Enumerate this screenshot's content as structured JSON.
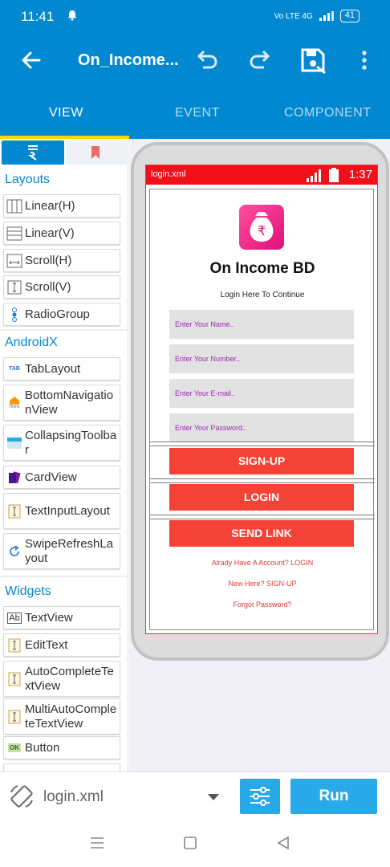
{
  "status_bar": {
    "time": "11:41",
    "network": "Vo LTE  4G",
    "battery": "41"
  },
  "toolbar": {
    "title": "On_Income..."
  },
  "tabs": [
    {
      "label": "VIEW",
      "active": true
    },
    {
      "label": "EVENT",
      "active": false
    },
    {
      "label": "COMPONENT",
      "active": false
    }
  ],
  "palette": {
    "sections": {
      "layouts": "Layouts",
      "androidx": "AndroidX",
      "widgets": "Widgets"
    },
    "layouts": [
      "Linear(H)",
      "Linear(V)",
      "Scroll(H)",
      "Scroll(V)",
      "RadioGroup"
    ],
    "androidx": [
      "TabLayout",
      "BottomNavigationView",
      "CollapsingToolbar",
      "CardView",
      "TextInputLayout",
      "SwipeRefreshLayout"
    ],
    "widgets": [
      "TextView",
      "EditText",
      "AutoCompleteTextView",
      "MultiAutoCompleteTextView",
      "Button"
    ],
    "icon_tags": {
      "tab": "TAB",
      "home": "Home",
      "ab": "Ab",
      "ok": "OK"
    }
  },
  "preview": {
    "file": "login.xml",
    "time": "1:37",
    "title": "On Income BD",
    "subtitle": "Login Here To Continue",
    "fields": [
      "Enter Your Name..",
      "Enter Your Number..",
      "Enter Your E-mail..",
      "Enter Your Password.."
    ],
    "buttons": [
      "SIGN-UP",
      "LOGIN",
      "SEND LINK"
    ],
    "links": [
      "Alrady Have A Account? LOGIN",
      "New Here? SIGN-UP",
      "Forgot Password?"
    ],
    "logo_symbol": "₹"
  },
  "bottom_bar": {
    "file": "login.xml",
    "run_label": "Run"
  },
  "colors": {
    "primary": "#0288d1",
    "accent": "#ffd600",
    "preview_red": "#f44336",
    "run_blue": "#29a9e8"
  }
}
